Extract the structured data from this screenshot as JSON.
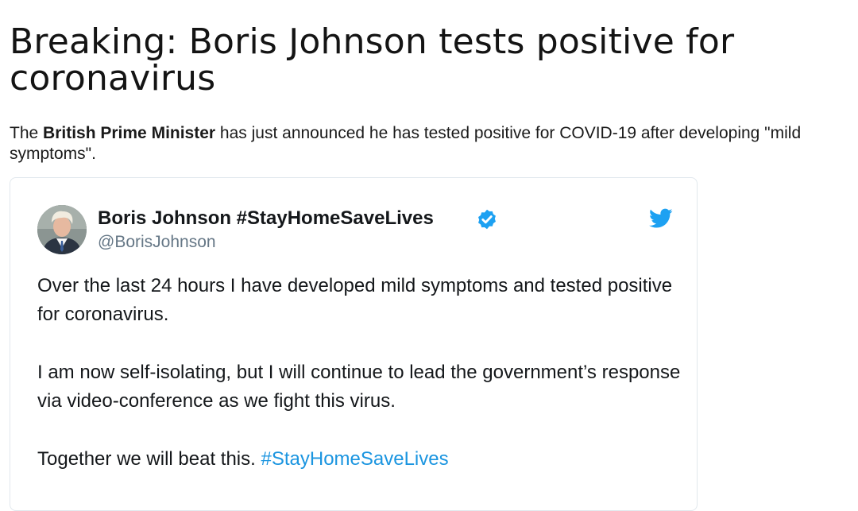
{
  "article": {
    "headline": "Breaking: Boris Johnson tests positive for coronavirus",
    "lede_part1": "The ",
    "lede_bold": "British Prime Minister",
    "lede_part2": " has just announced he has tested positive for COVID-19 after developing \"mild symptoms\"."
  },
  "tweet": {
    "author_name": "Boris Johnson #StayHomeSaveLives",
    "author_handle": "@BorisJohnson",
    "paragraph1": "Over the last 24 hours I have developed mild symptoms and tested positive for coronavirus.",
    "paragraph2": "I am now self-isolating, but I will continue to lead the government’s response via video-conference as we fight this virus.",
    "paragraph3_text": "Together we will beat this. ",
    "paragraph3_hashtag": "#StayHomeSaveLives",
    "icons": {
      "verified": "verified-badge-icon",
      "platform": "twitter-bird-icon"
    },
    "colors": {
      "link": "#1b95e0",
      "verified": "#1da1f2",
      "twitter": "#1da1f2",
      "handle": "#657786"
    }
  }
}
